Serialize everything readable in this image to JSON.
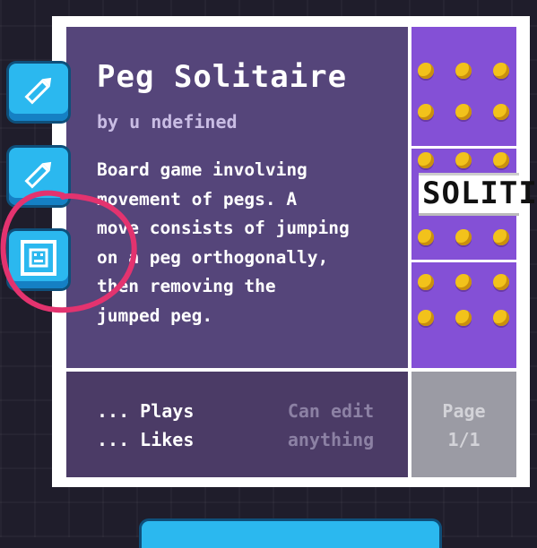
{
  "game": {
    "title": "Peg Solitaire",
    "author": "by u ndefined",
    "description_lines": [
      "Board game involving",
      "movement of pegs. A",
      "move consists of jumping",
      "on a peg orthogonally,",
      "then removing the",
      "jumped peg."
    ]
  },
  "stats": {
    "plays": "... Plays",
    "likes": "... Likes"
  },
  "permissions": {
    "line1": "Can edit",
    "line2": "anything"
  },
  "pagination": {
    "line1": "Page",
    "line2": "1/1"
  },
  "preview": {
    "banner_text": "SOLITI"
  },
  "side_tools": [
    {
      "icon": "pencil-icon"
    },
    {
      "icon": "pencil-icon"
    },
    {
      "icon": "face-icon"
    }
  ],
  "colors": {
    "panel": "#55457a",
    "stats_panel": "#4b3b66",
    "button": "#2bb8ef",
    "peg": "#f2c21b",
    "preview_bg": "#7f4bd1",
    "annotation": "#e3336f"
  }
}
